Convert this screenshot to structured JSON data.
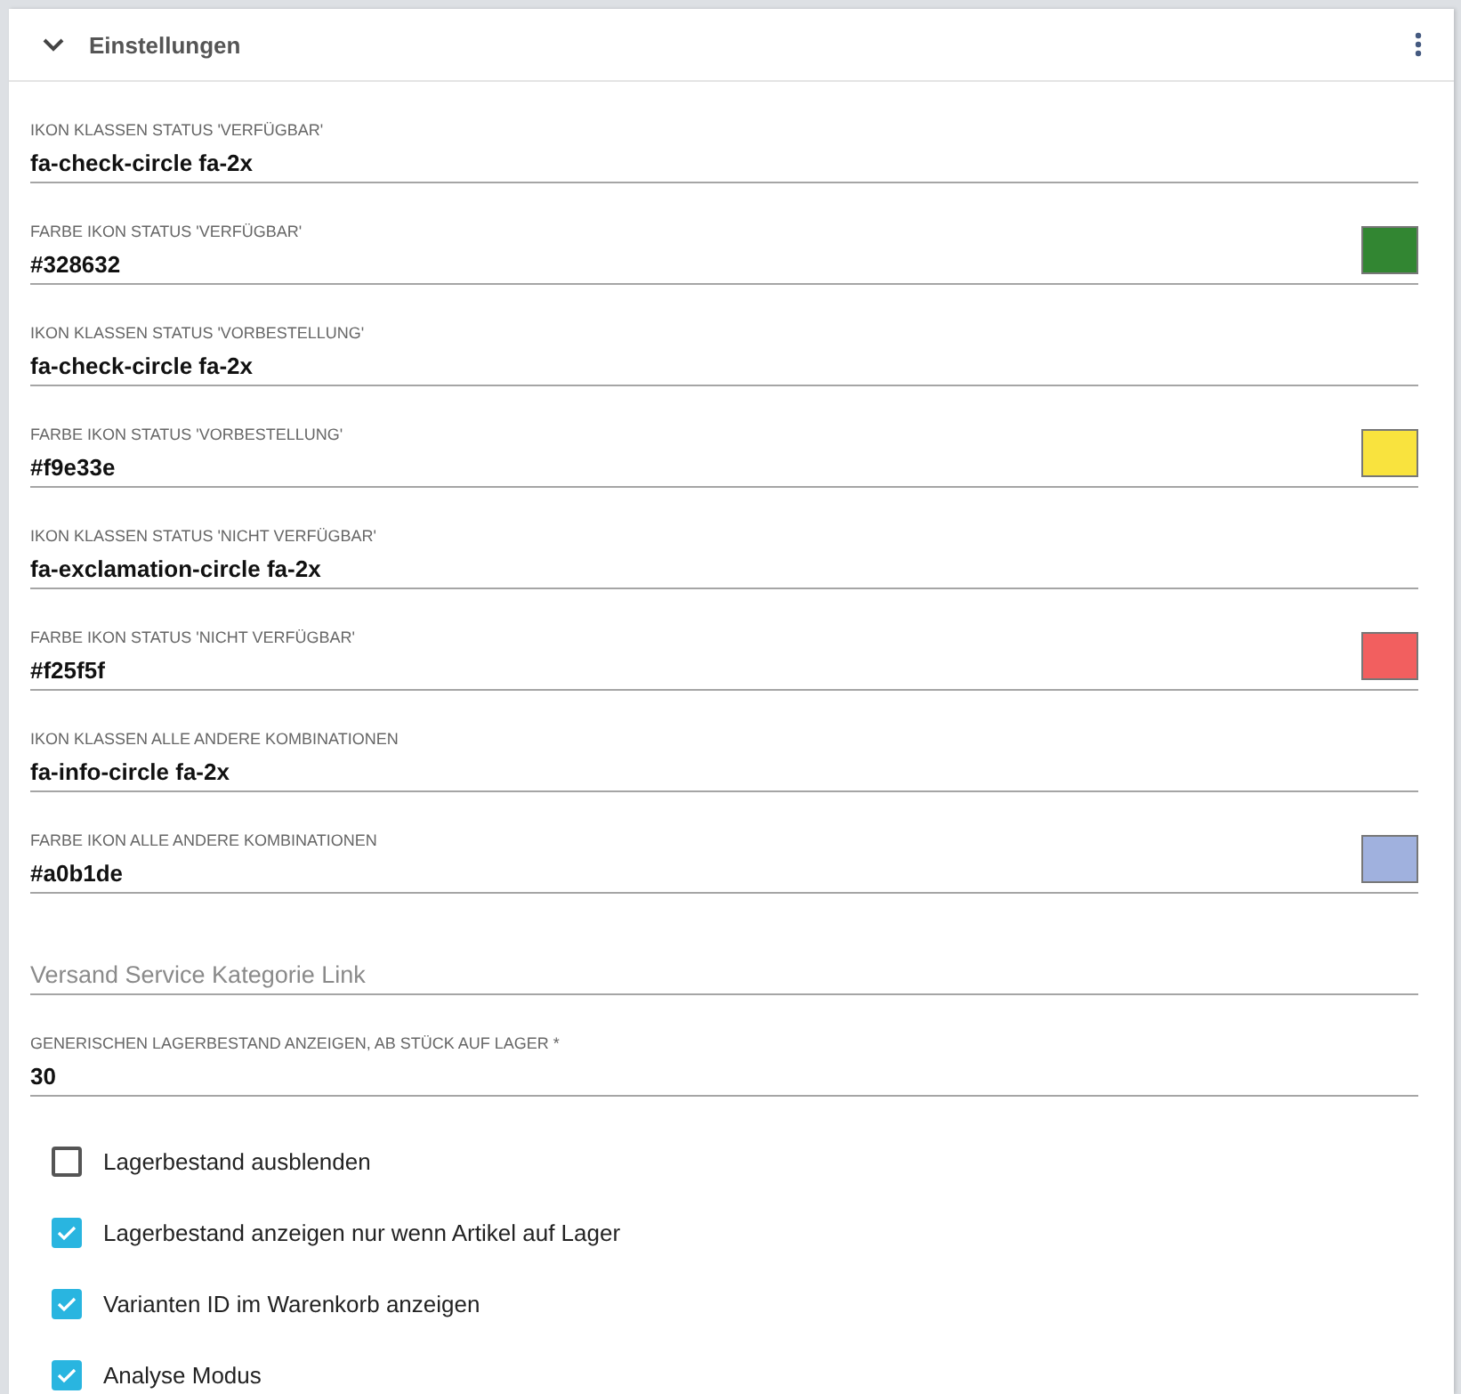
{
  "panel": {
    "title": "Einstellungen",
    "expanded": true
  },
  "fields": [
    {
      "label": "IKON KLASSEN STATUS 'VERFÜGBAR'",
      "value": "fa-check-circle fa-2x"
    },
    {
      "label": "FARBE IKON STATUS 'VERFÜGBAR'",
      "value": "#328632",
      "color": "#328632"
    },
    {
      "label": "IKON KLASSEN STATUS 'VORBESTELLUNG'",
      "value": "fa-check-circle fa-2x"
    },
    {
      "label": "FARBE IKON STATUS 'VORBESTELLUNG'",
      "value": "#f9e33e",
      "color": "#f9e33e"
    },
    {
      "label": "IKON KLASSEN STATUS 'NICHT VERFÜGBAR'",
      "value": "fa-exclamation-circle fa-2x"
    },
    {
      "label": "FARBE IKON STATUS 'NICHT VERFÜGBAR'",
      "value": "#f25f5f",
      "color": "#f25f5f"
    },
    {
      "label": "IKON KLASSEN ALLE ANDERE KOMBINATIONEN",
      "value": "fa-info-circle fa-2x"
    },
    {
      "label": "FARBE IKON ALLE ANDERE KOMBINATIONEN",
      "value": "#a0b1de",
      "color": "#a0b1de"
    },
    {
      "placeholder": "Versand Service Kategorie Link"
    },
    {
      "label": "GENERISCHEN LAGERBESTAND ANZEIGEN, AB STÜCK AUF LAGER *",
      "value": "30"
    }
  ],
  "checkboxes": [
    {
      "label": "Lagerbestand ausblenden",
      "checked": false
    },
    {
      "label": "Lagerbestand anzeigen nur wenn Artikel auf Lager",
      "checked": true
    },
    {
      "label": "Varianten ID im Warenkorb anzeigen",
      "checked": true
    },
    {
      "label": "Analyse Modus",
      "checked": true
    }
  ]
}
